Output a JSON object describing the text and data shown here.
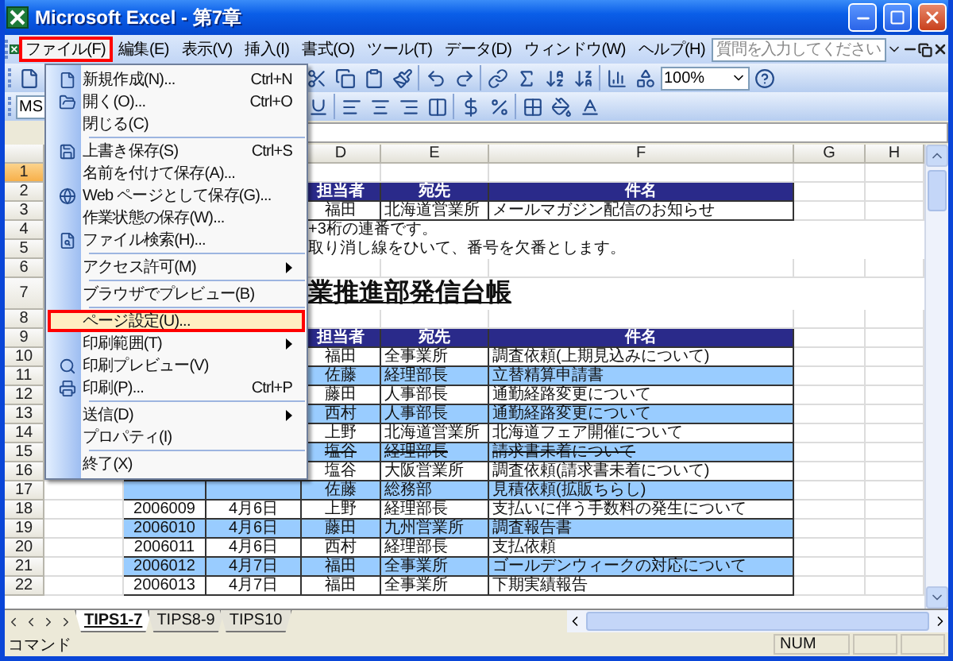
{
  "window": {
    "title": "Microsoft Excel - 第7章"
  },
  "menu_bar": {
    "items": [
      {
        "label": "ファイル(F)",
        "selected": true
      },
      {
        "label": "編集(E)",
        "selected": false
      },
      {
        "label": "表示(V)",
        "selected": false
      },
      {
        "label": "挿入(I)",
        "selected": false
      },
      {
        "label": "書式(O)",
        "selected": false
      },
      {
        "label": "ツール(T)",
        "selected": false
      },
      {
        "label": "データ(D)",
        "selected": false
      },
      {
        "label": "ウィンドウ(W)",
        "selected": false
      },
      {
        "label": "ヘルプ(H)",
        "selected": false
      }
    ],
    "question_box": {
      "placeholder": "質問を入力してください"
    }
  },
  "toolbar": {
    "font_name": "MS",
    "zoom": "100%"
  },
  "file_menu": {
    "items": [
      {
        "kind": "item",
        "label": "新規作成(N)...",
        "shortcut": "Ctrl+N",
        "selected": false
      },
      {
        "kind": "item",
        "label": "開く(O)...",
        "shortcut": "Ctrl+O",
        "selected": false
      },
      {
        "kind": "item",
        "label": "閉じる(C)",
        "selected": false
      },
      {
        "kind": "separator"
      },
      {
        "kind": "item",
        "label": "上書き保存(S)",
        "shortcut": "Ctrl+S",
        "selected": false
      },
      {
        "kind": "item",
        "label": "名前を付けて保存(A)...",
        "selected": false
      },
      {
        "kind": "item",
        "label": "Web ページとして保存(G)...",
        "selected": false
      },
      {
        "kind": "item",
        "label": "作業状態の保存(W)...",
        "selected": false
      },
      {
        "kind": "item",
        "label": "ファイル検索(H)...",
        "selected": false
      },
      {
        "kind": "separator"
      },
      {
        "kind": "submenu",
        "label": "アクセス許可(M)",
        "selected": false
      },
      {
        "kind": "separator"
      },
      {
        "kind": "item",
        "label": "ブラウザでプレビュー(B)",
        "selected": false
      },
      {
        "kind": "separator"
      },
      {
        "kind": "item",
        "label": "ページ設定(U)...",
        "selected": true
      },
      {
        "kind": "submenu",
        "label": "印刷範囲(T)",
        "selected": false
      },
      {
        "kind": "item",
        "label": "印刷プレビュー(V)",
        "selected": false
      },
      {
        "kind": "item",
        "label": "印刷(P)...",
        "shortcut": "Ctrl+P",
        "selected": false
      },
      {
        "kind": "separator"
      },
      {
        "kind": "submenu",
        "label": "送信(D)",
        "selected": false
      },
      {
        "kind": "item",
        "label": "プロパティ(I)",
        "selected": false
      },
      {
        "kind": "separator"
      },
      {
        "kind": "item",
        "label": "終了(X)",
        "selected": false
      }
    ]
  },
  "sheet": {
    "columns": [
      "D",
      "E",
      "F",
      "G",
      "H"
    ],
    "rows": [
      {
        "number": "1",
        "kind": "blank",
        "selected": true
      },
      {
        "number": "2",
        "kind": "header",
        "selected": false,
        "cells": [
          "担当者",
          "宛先",
          "件名"
        ]
      },
      {
        "number": "3",
        "kind": "data",
        "selected": false,
        "shaded": false,
        "struck": false,
        "d": "福田",
        "e": "北海道営業所",
        "f": "メールマガジン配信のお知らせ"
      },
      {
        "number": "4",
        "kind": "note",
        "selected": false,
        "text": "+3桁の連番です。"
      },
      {
        "number": "5",
        "kind": "note",
        "selected": false,
        "text": "取り消し線をひいて、番号を欠番とします。"
      },
      {
        "number": "6",
        "kind": "blank",
        "selected": false
      },
      {
        "number": "7",
        "kind": "title",
        "selected": false,
        "text": "業推進部発信台帳"
      },
      {
        "number": "8",
        "kind": "blank",
        "selected": false
      },
      {
        "number": "9",
        "kind": "header",
        "selected": false,
        "cells": [
          "担当者",
          "宛先",
          "件名"
        ]
      },
      {
        "number": "10",
        "kind": "data",
        "selected": false,
        "shaded": false,
        "struck": false,
        "d": "福田",
        "e": "全事業所",
        "f": "調査依頼(上期見込みについて)"
      },
      {
        "number": "11",
        "kind": "data",
        "selected": false,
        "shaded": true,
        "struck": false,
        "d": "佐藤",
        "e": "経理部長",
        "f": "立替精算申請書"
      },
      {
        "number": "12",
        "kind": "data",
        "selected": false,
        "shaded": false,
        "struck": false,
        "d": "藤田",
        "e": "人事部長",
        "f": "通勤経路変更について"
      },
      {
        "number": "13",
        "kind": "data",
        "selected": false,
        "shaded": true,
        "struck": false,
        "d": "西村",
        "e": "人事部長",
        "f": "通勤経路変更について"
      },
      {
        "number": "14",
        "kind": "data",
        "selected": false,
        "shaded": false,
        "struck": false,
        "d": "上野",
        "e": "北海道営業所",
        "f": "北海道フェア開催について"
      },
      {
        "number": "15",
        "kind": "data",
        "selected": false,
        "shaded": true,
        "struck": true,
        "d": "塩谷",
        "e": "経理部長",
        "f": "請求書未着について"
      },
      {
        "number": "16",
        "kind": "data",
        "selected": false,
        "shaded": false,
        "struck": false,
        "d": "塩谷",
        "e": "大阪営業所",
        "f": "調査依頼(請求書未着について)"
      },
      {
        "number": "17",
        "kind": "data",
        "selected": false,
        "shaded": true,
        "struck": false,
        "d": "佐藤",
        "e": "総務部",
        "f": "見積依頼(拡販ちらし)"
      },
      {
        "number": "18",
        "kind": "data",
        "selected": false,
        "shaded": false,
        "struck": false,
        "b": "2006009",
        "c": "4月6日",
        "d": "上野",
        "e": "経理部長",
        "f": "支払いに伴う手数料の発生について"
      },
      {
        "number": "19",
        "kind": "data",
        "selected": false,
        "shaded": true,
        "struck": false,
        "b": "2006010",
        "c": "4月6日",
        "d": "藤田",
        "e": "九州営業所",
        "f": "調査報告書"
      },
      {
        "number": "20",
        "kind": "data",
        "selected": false,
        "shaded": false,
        "struck": false,
        "b": "2006011",
        "c": "4月6日",
        "d": "西村",
        "e": "経理部長",
        "f": "支払依頼"
      },
      {
        "number": "21",
        "kind": "data",
        "selected": false,
        "shaded": true,
        "struck": false,
        "b": "2006012",
        "c": "4月7日",
        "d": "福田",
        "e": "全事業所",
        "f": "ゴールデンウィークの対応について"
      },
      {
        "number": "22",
        "kind": "data",
        "selected": false,
        "shaded": false,
        "struck": false,
        "b": "2006013",
        "c": "4月7日",
        "d": "福田",
        "e": "全事業所",
        "f": "下期実績報告"
      }
    ]
  },
  "sheet_tabs": [
    {
      "label": "TIPS1-7",
      "selected": true
    },
    {
      "label": "TIPS8-9",
      "selected": false
    },
    {
      "label": "TIPS10",
      "selected": false
    }
  ],
  "status_bar": {
    "mode": "コマンド",
    "indicator": "NUM"
  }
}
